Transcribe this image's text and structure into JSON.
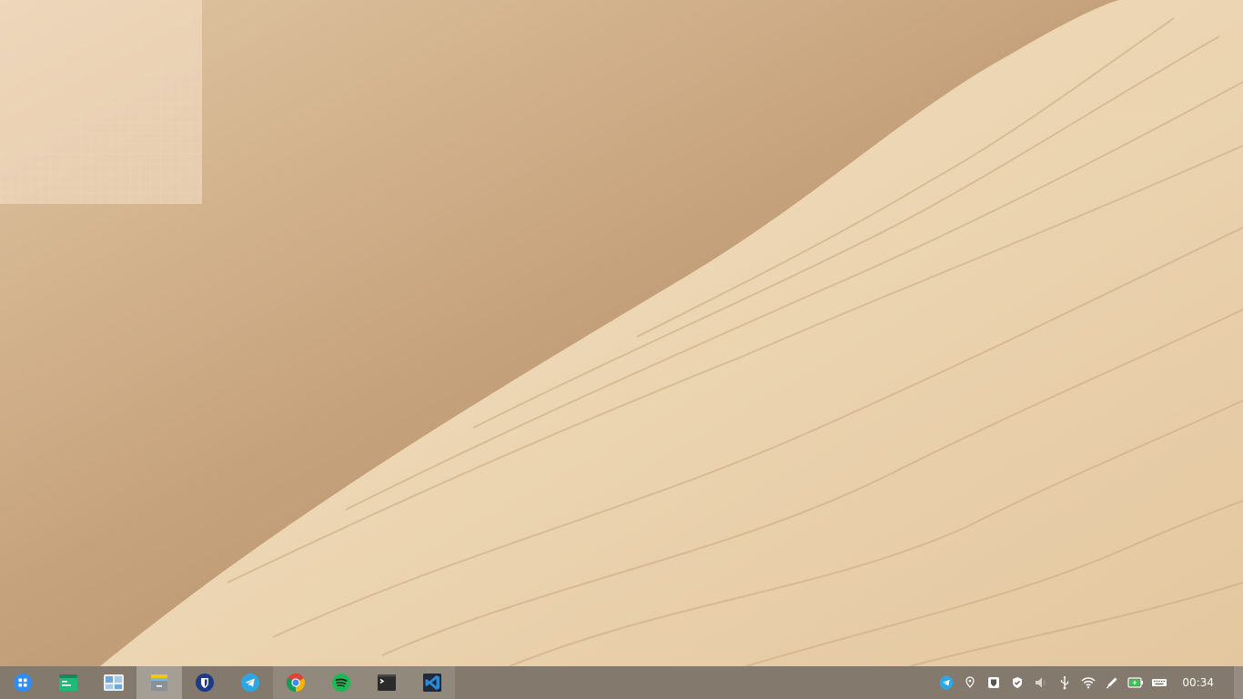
{
  "desktop": {
    "wallpaper": "sand-dune-wallpaper",
    "colors": {
      "sand_light": "#efdbbd",
      "sand_shadow": "#b8916b"
    }
  },
  "taskbar": {
    "background": "#786e5f",
    "apps": [
      {
        "name": "launcher",
        "icon": "app-grid-icon",
        "state": "normal"
      },
      {
        "name": "terminal-manager",
        "icon": "green-terminal-icon",
        "state": "normal"
      },
      {
        "name": "multitasking-view",
        "icon": "workspaces-icon",
        "state": "normal"
      },
      {
        "name": "file-manager",
        "icon": "archive-folder-icon",
        "state": "active"
      },
      {
        "name": "bitwarden",
        "icon": "bitwarden-shield-icon",
        "state": "normal"
      },
      {
        "name": "telegram",
        "icon": "telegram-plane-icon",
        "state": "normal"
      },
      {
        "name": "chrome",
        "icon": "chrome-icon",
        "state": "running"
      },
      {
        "name": "spotify",
        "icon": "spotify-icon",
        "state": "running"
      },
      {
        "name": "terminal",
        "icon": "terminal-icon",
        "state": "running"
      },
      {
        "name": "vscode",
        "icon": "vscode-icon",
        "state": "running"
      }
    ],
    "tray": [
      "telegram-tray-icon",
      "location-pin-icon",
      "bitwarden-tray-icon",
      "shield-check-icon",
      "volume-icon",
      "usb-icon",
      "wifi-icon",
      "pen-icon",
      "battery-charging-icon",
      "keyboard-icon"
    ],
    "clock": "00:34"
  }
}
